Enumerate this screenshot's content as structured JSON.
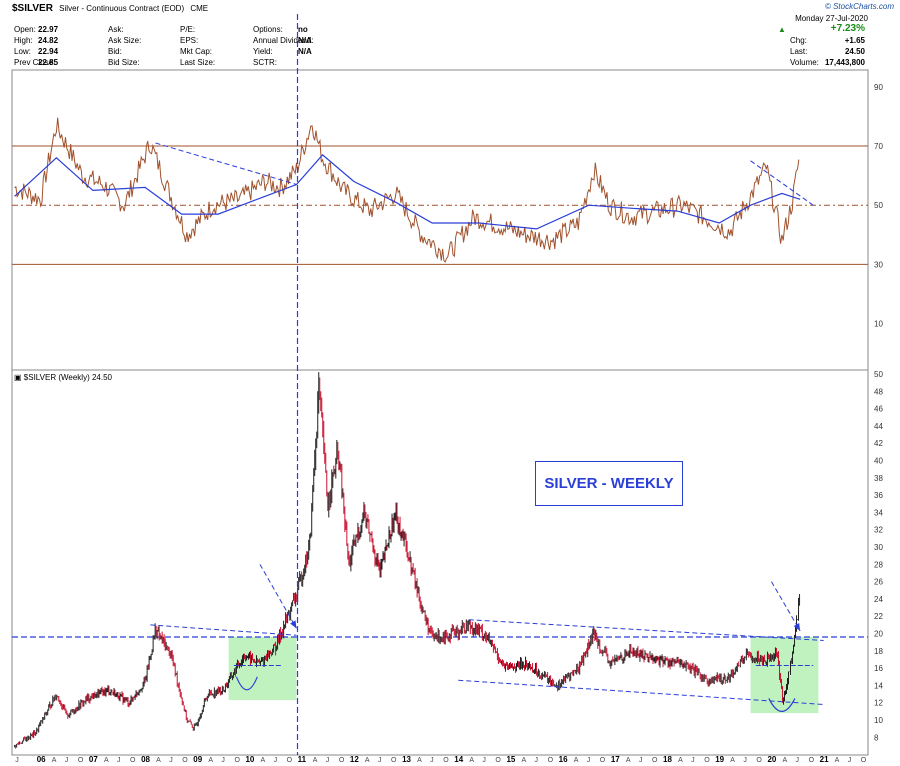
{
  "header": {
    "symbol": "$SILVER",
    "subtitle": "Silver - Continuous Contract (EOD)",
    "exchange": "CME",
    "brand": "© StockCharts.com",
    "date_line": "Monday  27-Jul-2020",
    "col1": [
      {
        "label": "Open:",
        "value": "22.97"
      },
      {
        "label": "High:",
        "value": "24.82"
      },
      {
        "label": "Low:",
        "value": "22.94"
      },
      {
        "label": "Prev Close:",
        "value": "22.85"
      }
    ],
    "col2": [
      {
        "label": "Ask:",
        "value": ""
      },
      {
        "label": "Ask Size:",
        "value": ""
      },
      {
        "label": "Bid:",
        "value": ""
      },
      {
        "label": "Bid Size:",
        "value": ""
      }
    ],
    "col3": [
      {
        "label": "P/E:",
        "value": ""
      },
      {
        "label": "EPS:",
        "value": ""
      },
      {
        "label": "Mkt Cap:",
        "value": ""
      },
      {
        "label": "Last Size:",
        "value": ""
      }
    ],
    "col4": [
      {
        "label": "Options:",
        "value": "no"
      },
      {
        "label": "Annual Dividend:",
        "value": "N/A"
      },
      {
        "label": "Yield:",
        "value": "N/A"
      },
      {
        "label": "SCTR:",
        "value": ""
      }
    ],
    "col5": [
      {
        "label": "",
        "value": "+7.23%"
      },
      {
        "label": "Chg:",
        "value": "+1.65"
      },
      {
        "label": "Last:",
        "value": "24.50"
      },
      {
        "label": "Volume:",
        "value": "17,443,800"
      }
    ]
  },
  "price_panel_label": "$SILVER (Weekly) 24.50",
  "annotation_box": "SILVER  - WEEKLY",
  "colors": {
    "price_bar": "#202020",
    "price_down": "#c8102e",
    "indicator": "#a0522d",
    "indicator_ma": "#2a3ed8",
    "trendline": "#2a3ed8",
    "highlight": "#b5f0b5"
  },
  "chart_data": [
    {
      "type": "line",
      "title": "",
      "y_ticks": [
        90,
        70,
        50,
        30,
        10
      ],
      "ylim": [
        -5,
        95
      ],
      "reference_lines": [
        70,
        50,
        30
      ],
      "series": [
        {
          "x": [
            2005.5,
            2006.0,
            2006.3,
            2006.8,
            2007.2,
            2007.6,
            2008.1,
            2008.4,
            2008.8,
            2009.3,
            2009.8,
            2010.3,
            2010.6,
            2010.9,
            2011.2,
            2011.4,
            2011.8,
            2012.3,
            2012.8,
            2013.3,
            2013.8,
            2014.3,
            2014.8,
            2015.3,
            2015.8,
            2016.3,
            2016.6,
            2016.9,
            2017.3,
            2017.8,
            2018.3,
            2018.8,
            2019.2,
            2019.6,
            2019.9,
            2020.2,
            2020.4,
            2020.55
          ],
          "values": [
            56,
            52,
            77,
            60,
            57,
            50,
            71,
            57,
            40,
            50,
            52,
            58,
            56,
            62,
            78,
            66,
            55,
            48,
            54,
            40,
            33,
            46,
            43,
            40,
            38,
            44,
            62,
            50,
            46,
            48,
            50,
            45,
            41,
            53,
            63,
            38,
            51,
            68
          ]
        },
        {
          "x": [
            2005.5,
            2006.3,
            2007.0,
            2008.0,
            2008.7,
            2009.4,
            2010.3,
            2010.9,
            2011.4,
            2012.0,
            2012.8,
            2013.5,
            2014.4,
            2015.5,
            2016.5,
            2017.3,
            2018.2,
            2019.0,
            2019.6,
            2020.2,
            2020.55
          ],
          "values": [
            53,
            66,
            55,
            56,
            47,
            47,
            53,
            57,
            67,
            58,
            51,
            44,
            44,
            42,
            50,
            49,
            48,
            44,
            50,
            54,
            52
          ]
        }
      ]
    },
    {
      "type": "bar",
      "title": "SILVER  - WEEKLY",
      "x_ticks": [
        "06",
        "07",
        "08",
        "09",
        "10",
        "11",
        "12",
        "13",
        "14",
        "15",
        "16",
        "17",
        "18",
        "19",
        "20",
        "21"
      ],
      "y_ticks": [
        50,
        48,
        46,
        44,
        42,
        40,
        38,
        36,
        34,
        32,
        30,
        28,
        26,
        24,
        22,
        20,
        18,
        16,
        14,
        12,
        10,
        8
      ],
      "ylim": [
        7,
        50
      ],
      "last": 24.5,
      "support_resistance": 19.6,
      "close_points": [
        [
          2005.5,
          7.0
        ],
        [
          2005.9,
          8.5
        ],
        [
          2006.3,
          13.0
        ],
        [
          2006.5,
          10.5
        ],
        [
          2006.9,
          12.5
        ],
        [
          2007.3,
          13.5
        ],
        [
          2007.7,
          12.0
        ],
        [
          2008.0,
          14.5
        ],
        [
          2008.2,
          20.5
        ],
        [
          2008.5,
          17.5
        ],
        [
          2008.8,
          10.0
        ],
        [
          2008.95,
          9.0
        ],
        [
          2009.2,
          13.0
        ],
        [
          2009.5,
          13.5
        ],
        [
          2009.9,
          17.5
        ],
        [
          2010.2,
          16.5
        ],
        [
          2010.5,
          18.5
        ],
        [
          2010.9,
          24.5
        ],
        [
          2011.15,
          30.0
        ],
        [
          2011.33,
          48.5
        ],
        [
          2011.5,
          35.0
        ],
        [
          2011.7,
          41.0
        ],
        [
          2011.9,
          28.0
        ],
        [
          2012.2,
          34.0
        ],
        [
          2012.5,
          27.0
        ],
        [
          2012.8,
          34.0
        ],
        [
          2013.0,
          30.0
        ],
        [
          2013.3,
          23.0
        ],
        [
          2013.5,
          19.5
        ],
        [
          2013.9,
          20.0
        ],
        [
          2014.2,
          21.0
        ],
        [
          2014.5,
          20.0
        ],
        [
          2014.9,
          16.0
        ],
        [
          2015.3,
          16.5
        ],
        [
          2015.9,
          14.0
        ],
        [
          2016.3,
          16.0
        ],
        [
          2016.6,
          20.0
        ],
        [
          2016.9,
          16.5
        ],
        [
          2017.3,
          18.0
        ],
        [
          2017.8,
          17.0
        ],
        [
          2018.3,
          16.5
        ],
        [
          2018.8,
          14.5
        ],
        [
          2019.2,
          15.0
        ],
        [
          2019.5,
          17.5
        ],
        [
          2019.9,
          17.0
        ],
        [
          2020.1,
          18.0
        ],
        [
          2020.22,
          12.0
        ],
        [
          2020.4,
          17.5
        ],
        [
          2020.55,
          24.5
        ]
      ]
    }
  ]
}
